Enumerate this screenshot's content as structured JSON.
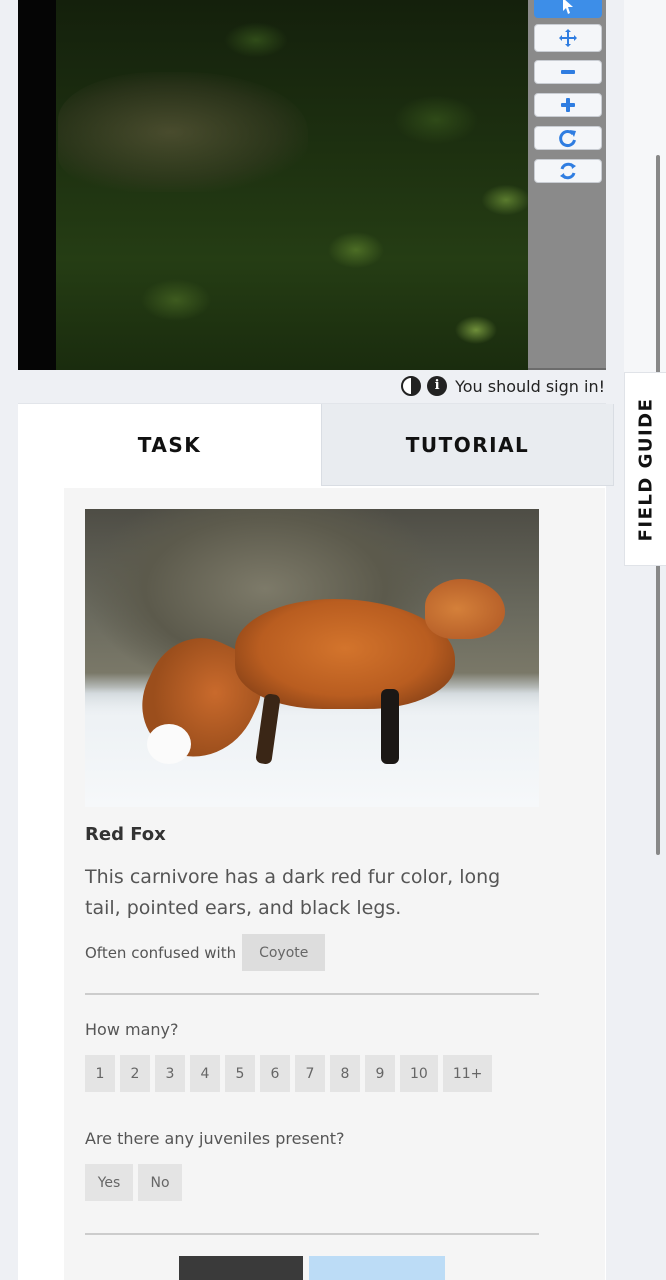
{
  "viewer": {
    "tools": [
      {
        "icon": "pointer-icon",
        "active": true
      },
      {
        "icon": "move-icon",
        "active": false
      },
      {
        "icon": "zoom-out-icon",
        "active": false
      },
      {
        "icon": "zoom-in-icon",
        "active": false
      },
      {
        "icon": "rotate-icon",
        "active": false
      },
      {
        "icon": "reset-icon",
        "active": false
      }
    ],
    "signin_text": "You should sign in!",
    "icons": [
      "contrast-icon",
      "info-icon"
    ]
  },
  "tabs": [
    {
      "label": "TASK",
      "active": true
    },
    {
      "label": "TUTORIAL",
      "active": false
    }
  ],
  "field_guide_label": "FIELD GUIDE",
  "species": {
    "name": "Red Fox",
    "description": "This carnivore has a dark red fur color, long tail, pointed ears, and black legs.",
    "confused_label": "Often confused with",
    "confused_with": [
      "Coyote"
    ]
  },
  "questions": [
    {
      "label": "How many?",
      "options": [
        "1",
        "2",
        "3",
        "4",
        "5",
        "6",
        "7",
        "8",
        "9",
        "10",
        "11+"
      ]
    },
    {
      "label": "Are there any juveniles present?",
      "options": [
        "Yes",
        "No"
      ]
    }
  ],
  "colors": {
    "accent": "#3d8ee8",
    "panel_bg": "#f5f5f5",
    "page_bg": "#eef0f4"
  }
}
